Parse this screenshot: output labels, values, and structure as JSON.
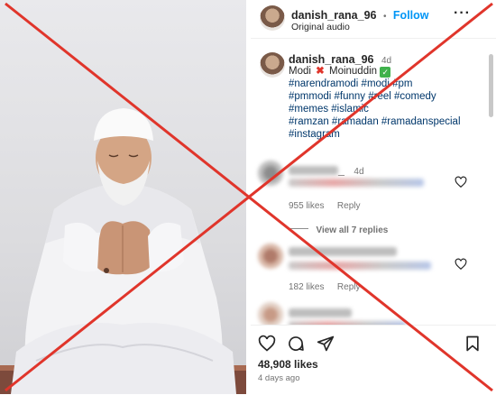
{
  "post": {
    "username": "danish_rana_96",
    "separator": "•",
    "follow_label": "Follow",
    "audio": "Original audio"
  },
  "caption": {
    "username": "danish_rana_96",
    "time": "4d",
    "text_a": "Modi",
    "text_b": "Moinuddin",
    "hashtags_line1": "#narendramodi #modi #pm",
    "hashtags_line2": "#pmmodi #funny #reel #comedy",
    "hashtags_line3": "#memes #islamic",
    "hashtags_line4": "#ramzan #ramadan #ramadanspecial",
    "hashtags_line5": "#instagram"
  },
  "comments": [
    {
      "name_suffix": "_",
      "time": "4d",
      "likes": "955 likes",
      "reply": "Reply"
    },
    {
      "likes": "182 likes",
      "reply": "Reply"
    }
  ],
  "view_replies": "View all 7 replies",
  "footer": {
    "likes": "48,908 likes",
    "time": "4 days ago"
  },
  "colors": {
    "cross": "#e0352b",
    "link": "#0095f6",
    "hashtag": "#00376b"
  },
  "icons": [
    "heart-icon",
    "comment-icon",
    "share-icon",
    "bookmark-icon",
    "more-icon",
    "cross-mark-icon",
    "verified-check-icon"
  ]
}
